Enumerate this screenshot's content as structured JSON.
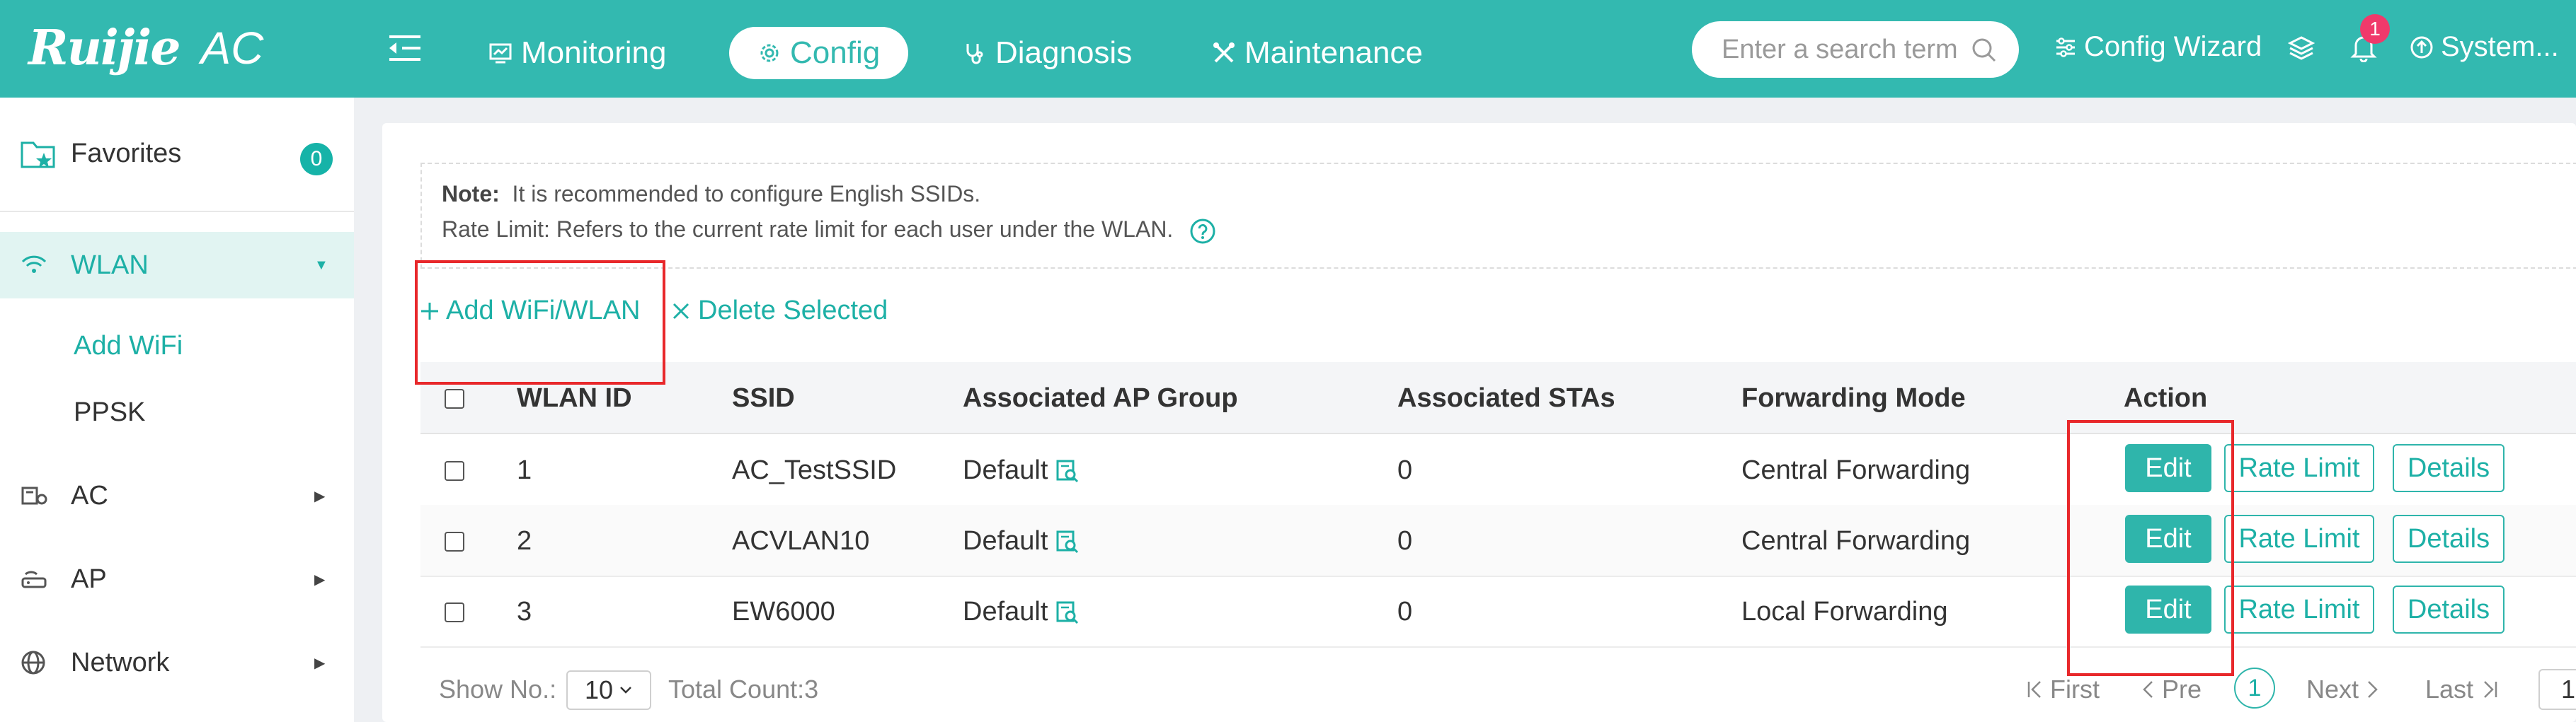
{
  "brand": {
    "logo": "Ruijie",
    "product": "AC"
  },
  "nav": {
    "items": [
      {
        "label": "Monitoring",
        "icon": "monitor-chart-icon"
      },
      {
        "label": "Config",
        "icon": "gear-icon",
        "active": true
      },
      {
        "label": "Diagnosis",
        "icon": "stethoscope-icon"
      },
      {
        "label": "Maintenance",
        "icon": "tools-icon"
      }
    ]
  },
  "search": {
    "placeholder": "Enter a search term"
  },
  "topbar": {
    "config_wizard": "Config Wizard",
    "notifications_count": "1",
    "system": "System..."
  },
  "sidebar": {
    "favorites": {
      "label": "Favorites",
      "count": "0"
    },
    "items": [
      {
        "label": "WLAN",
        "icon": "wifi-icon",
        "expanded": true
      },
      {
        "label": "AC",
        "icon": "ac-device-icon"
      },
      {
        "label": "AP",
        "icon": "ap-device-icon"
      },
      {
        "label": "Network",
        "icon": "globe-icon"
      }
    ],
    "wlan_sub": [
      {
        "label": "Add WiFi",
        "active": true
      },
      {
        "label": "PPSK"
      }
    ]
  },
  "note": {
    "title": "Note:",
    "line1": "It is recommended to configure English SSIDs.",
    "line2": "Rate Limit: Refers to the current rate limit for each user under the WLAN."
  },
  "actions": {
    "add": "Add WiFi/WLAN",
    "delete": "Delete Selected"
  },
  "table": {
    "columns": [
      "WLAN ID",
      "SSID",
      "Associated AP Group",
      "Associated STAs",
      "Forwarding Mode",
      "Action"
    ],
    "rows": [
      {
        "id": "1",
        "ssid": "AC_TestSSID",
        "group": "Default",
        "stas": "0",
        "mode": "Central Forwarding"
      },
      {
        "id": "2",
        "ssid": "ACVLAN10",
        "group": "Default",
        "stas": "0",
        "mode": "Central Forwarding"
      },
      {
        "id": "3",
        "ssid": "EW6000",
        "group": "Default",
        "stas": "0",
        "mode": "Local Forwarding"
      }
    ],
    "row_actions": {
      "edit": "Edit",
      "rate_limit": "Rate Limit",
      "details": "Details"
    }
  },
  "pagination": {
    "show_no_label": "Show No.:",
    "page_size": "10",
    "total": "Total Count:3",
    "first": "First",
    "prev": "Pre",
    "current_page": "1",
    "next": "Next",
    "last": "Last",
    "page_input": "1"
  },
  "colors": {
    "brand": "#33b9b0",
    "accent": "#1db0a6",
    "highlight_box": "#e8282b",
    "badge": "#f0396b"
  }
}
